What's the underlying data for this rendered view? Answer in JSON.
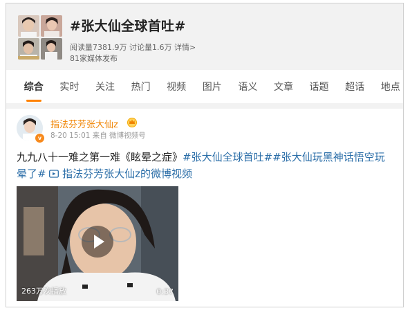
{
  "topic": {
    "title": "#张大仙全球首吐#",
    "stats": "阅读量7381.9万 讨论量1.6万 详情>",
    "media": "81家媒体发布"
  },
  "tabs": [
    "综合",
    "实时",
    "关注",
    "热门",
    "视频",
    "图片",
    "语义",
    "文章",
    "话题",
    "超话",
    "地点"
  ],
  "colors": {
    "accent": "#ff8200",
    "author": "#f08300",
    "link": "#2b6ea8"
  },
  "post": {
    "author": "指法芬芳张大仙z",
    "meta": "8-20 15:01 来自 微博视频号",
    "text_plain": "九九八十一难之第一难《眩晕之症》",
    "hashtag1": "#张大仙全球首吐#",
    "hashtag2": "#张大仙玩黑神话悟空玩晕了#",
    "video_link": "指法芬芳张大仙z的微博视频",
    "video": {
      "plays": "263万次播放",
      "duration": "0:37"
    }
  }
}
